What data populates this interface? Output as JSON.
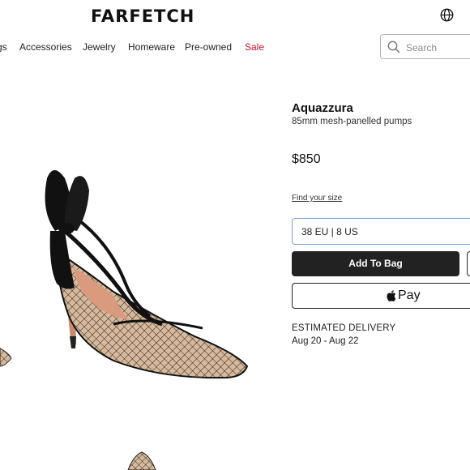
{
  "header": {
    "brand": "FARFETCH",
    "globe_icon": "globe-icon"
  },
  "nav": {
    "items": [
      {
        "label": "gs"
      },
      {
        "label": "Accessories"
      },
      {
        "label": "Jewelry"
      },
      {
        "label": "Homeware"
      },
      {
        "label": "Pre-owned"
      },
      {
        "label": "Sale"
      }
    ],
    "sale_color": "#c8102e"
  },
  "search": {
    "placeholder": "Search",
    "icon": "search-icon"
  },
  "product": {
    "designer": "Aquazzura",
    "name": "85mm mesh-panelled pumps",
    "price": "$850",
    "find_size": "Find your size",
    "selected_size": "38 EU | 8 US",
    "add_to_bag": "Add To Bag",
    "apple_pay": "Pay",
    "delivery_title": "ESTIMATED DELIVERY",
    "delivery_dates": "Aug 20 - Aug 22"
  },
  "colors": {
    "button_bg": "#222222",
    "select_border": "#7aa0d4"
  }
}
